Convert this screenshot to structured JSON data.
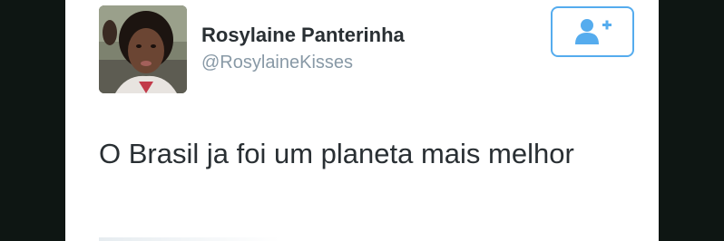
{
  "tweet": {
    "display_name": "Rosylaine Panterinha",
    "handle": "@RosylaineKisses",
    "text": "O Brasil ja foi um planeta mais melhor"
  },
  "follow_button": {
    "icon": "add-user-icon",
    "color": "#55acee"
  },
  "colors": {
    "name_text": "#292f33",
    "handle_text": "#8899a6",
    "background_bars": "#0e1613"
  }
}
